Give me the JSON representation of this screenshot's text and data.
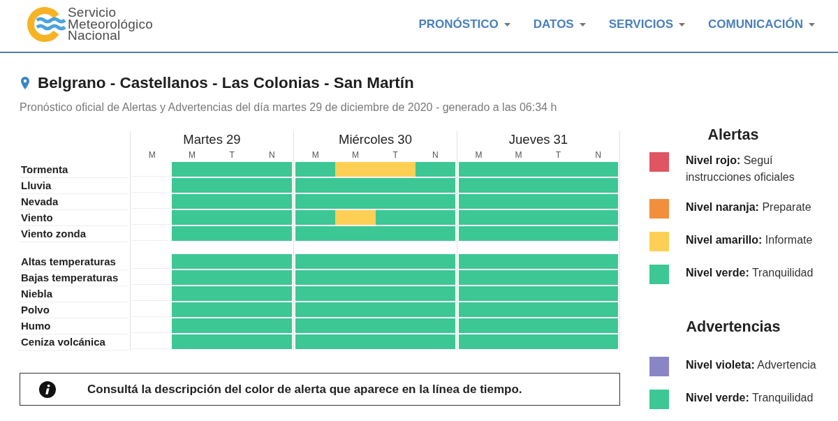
{
  "header": {
    "logo_lines": [
      "Servicio",
      "Meteorológico",
      "Nacional"
    ],
    "nav": [
      {
        "label": "PRONÓSTICO"
      },
      {
        "label": "DATOS"
      },
      {
        "label": "SERVICIOS"
      },
      {
        "label": "COMUNICACIÓN"
      }
    ]
  },
  "location": {
    "title": "Belgrano - Castellanos - Las Colonias - San Martín",
    "subtitle": "Pronóstico oficial de Alertas y Advertencias del día martes 29 de diciembre de 2020 - generado a las 06:34 h"
  },
  "timeline": {
    "days": [
      {
        "label": "Martes 29",
        "periods": [
          "M",
          "M",
          "T",
          "N"
        ]
      },
      {
        "label": "Miércoles 30",
        "periods": [
          "M",
          "M",
          "T",
          "N"
        ]
      },
      {
        "label": "Jueves 31",
        "periods": [
          "M",
          "M",
          "T",
          "N"
        ]
      }
    ],
    "groups": [
      {
        "rows": [
          {
            "label": "Tormenta",
            "alerts": [
              [
                {
                  "color": "#3cc795"
                },
                {
                  "color": "#3cc795"
                },
                {
                  "color": "#3cc795"
                }
              ],
              [
                {
                  "color": "#3cc795"
                },
                {
                  "color": "#fdd055"
                },
                {
                  "color": "#fdd055"
                },
                {
                  "color": "#3cc795"
                }
              ],
              [
                {
                  "color": "#3cc795"
                },
                {
                  "color": "#3cc795"
                },
                {
                  "color": "#3cc795"
                },
                {
                  "color": "#3cc795"
                }
              ]
            ]
          },
          {
            "label": "Lluvia",
            "alerts": [
              [
                {
                  "color": "#3cc795"
                },
                {
                  "color": "#3cc795"
                },
                {
                  "color": "#3cc795"
                }
              ],
              [
                {
                  "color": "#3cc795"
                },
                {
                  "color": "#3cc795"
                },
                {
                  "color": "#3cc795"
                },
                {
                  "color": "#3cc795"
                }
              ],
              [
                {
                  "color": "#3cc795"
                },
                {
                  "color": "#3cc795"
                },
                {
                  "color": "#3cc795"
                },
                {
                  "color": "#3cc795"
                }
              ]
            ]
          },
          {
            "label": "Nevada",
            "alerts": [
              [
                {
                  "color": "#3cc795"
                },
                {
                  "color": "#3cc795"
                },
                {
                  "color": "#3cc795"
                }
              ],
              [
                {
                  "color": "#3cc795"
                },
                {
                  "color": "#3cc795"
                },
                {
                  "color": "#3cc795"
                },
                {
                  "color": "#3cc795"
                }
              ],
              [
                {
                  "color": "#3cc795"
                },
                {
                  "color": "#3cc795"
                },
                {
                  "color": "#3cc795"
                },
                {
                  "color": "#3cc795"
                }
              ]
            ]
          },
          {
            "label": "Viento",
            "alerts": [
              [
                {
                  "color": "#3cc795"
                },
                {
                  "color": "#3cc795"
                },
                {
                  "color": "#3cc795"
                }
              ],
              [
                {
                  "color": "#3cc795"
                },
                {
                  "color": "#fdd055"
                },
                {
                  "color": "#3cc795"
                },
                {
                  "color": "#3cc795"
                }
              ],
              [
                {
                  "color": "#3cc795"
                },
                {
                  "color": "#3cc795"
                },
                {
                  "color": "#3cc795"
                },
                {
                  "color": "#3cc795"
                }
              ]
            ]
          },
          {
            "label": "Viento zonda",
            "alerts": [
              [
                {
                  "color": "#3cc795"
                },
                {
                  "color": "#3cc795"
                },
                {
                  "color": "#3cc795"
                }
              ],
              [
                {
                  "color": "#3cc795"
                },
                {
                  "color": "#3cc795"
                },
                {
                  "color": "#3cc795"
                },
                {
                  "color": "#3cc795"
                }
              ],
              [
                {
                  "color": "#3cc795"
                },
                {
                  "color": "#3cc795"
                },
                {
                  "color": "#3cc795"
                },
                {
                  "color": "#3cc795"
                }
              ]
            ]
          }
        ]
      },
      {
        "rows": [
          {
            "label": "Altas temperaturas",
            "alerts": [
              [
                {
                  "color": "#3cc795"
                },
                {
                  "color": "#3cc795"
                },
                {
                  "color": "#3cc795"
                }
              ],
              [
                {
                  "color": "#3cc795"
                },
                {
                  "color": "#3cc795"
                },
                {
                  "color": "#3cc795"
                },
                {
                  "color": "#3cc795"
                }
              ],
              [
                {
                  "color": "#3cc795"
                },
                {
                  "color": "#3cc795"
                },
                {
                  "color": "#3cc795"
                },
                {
                  "color": "#3cc795"
                }
              ]
            ]
          },
          {
            "label": "Bajas temperaturas",
            "alerts": [
              [
                {
                  "color": "#3cc795"
                },
                {
                  "color": "#3cc795"
                },
                {
                  "color": "#3cc795"
                }
              ],
              [
                {
                  "color": "#3cc795"
                },
                {
                  "color": "#3cc795"
                },
                {
                  "color": "#3cc795"
                },
                {
                  "color": "#3cc795"
                }
              ],
              [
                {
                  "color": "#3cc795"
                },
                {
                  "color": "#3cc795"
                },
                {
                  "color": "#3cc795"
                },
                {
                  "color": "#3cc795"
                }
              ]
            ]
          },
          {
            "label": "Niebla",
            "alerts": [
              [
                {
                  "color": "#3cc795"
                },
                {
                  "color": "#3cc795"
                },
                {
                  "color": "#3cc795"
                }
              ],
              [
                {
                  "color": "#3cc795"
                },
                {
                  "color": "#3cc795"
                },
                {
                  "color": "#3cc795"
                },
                {
                  "color": "#3cc795"
                }
              ],
              [
                {
                  "color": "#3cc795"
                },
                {
                  "color": "#3cc795"
                },
                {
                  "color": "#3cc795"
                },
                {
                  "color": "#3cc795"
                }
              ]
            ]
          },
          {
            "label": "Polvo",
            "alerts": [
              [
                {
                  "color": "#3cc795"
                },
                {
                  "color": "#3cc795"
                },
                {
                  "color": "#3cc795"
                }
              ],
              [
                {
                  "color": "#3cc795"
                },
                {
                  "color": "#3cc795"
                },
                {
                  "color": "#3cc795"
                },
                {
                  "color": "#3cc795"
                }
              ],
              [
                {
                  "color": "#3cc795"
                },
                {
                  "color": "#3cc795"
                },
                {
                  "color": "#3cc795"
                },
                {
                  "color": "#3cc795"
                }
              ]
            ]
          },
          {
            "label": "Humo",
            "alerts": [
              [
                {
                  "color": "#3cc795"
                },
                {
                  "color": "#3cc795"
                },
                {
                  "color": "#3cc795"
                }
              ],
              [
                {
                  "color": "#3cc795"
                },
                {
                  "color": "#3cc795"
                },
                {
                  "color": "#3cc795"
                },
                {
                  "color": "#3cc795"
                }
              ],
              [
                {
                  "color": "#3cc795"
                },
                {
                  "color": "#3cc795"
                },
                {
                  "color": "#3cc795"
                },
                {
                  "color": "#3cc795"
                }
              ]
            ]
          },
          {
            "label": "Ceniza volcánica",
            "alerts": [
              [
                {
                  "color": "#3cc795"
                },
                {
                  "color": "#3cc795"
                },
                {
                  "color": "#3cc795"
                }
              ],
              [
                {
                  "color": "#3cc795"
                },
                {
                  "color": "#3cc795"
                },
                {
                  "color": "#3cc795"
                },
                {
                  "color": "#3cc795"
                }
              ],
              [
                {
                  "color": "#3cc795"
                },
                {
                  "color": "#3cc795"
                },
                {
                  "color": "#3cc795"
                },
                {
                  "color": "#3cc795"
                }
              ]
            ]
          }
        ]
      }
    ]
  },
  "info": {
    "text": "Consultá la descripción del color de alerta que aparece en la línea de tiempo."
  },
  "legend": [
    {
      "title": "Alertas",
      "items": [
        {
          "text": "**Nivel rojo:** Seguí instrucciones oficiales",
          "color": "#df5561"
        },
        {
          "text": "**Nivel naranja:** Preparate",
          "color": "#f28f3c"
        },
        {
          "text": "**Nivel amarillo:** Informate",
          "color": "#fdd055"
        },
        {
          "text": "**Nivel verde:** Tranquilidad",
          "color": "#3cc795"
        }
      ]
    },
    {
      "title": "Advertencias",
      "items": [
        {
          "text": "**Nivel violeta:** Advertencia",
          "color": "#8a86c6"
        },
        {
          "text": "**Nivel verde:** Tranquilidad",
          "color": "#3cc795"
        }
      ]
    }
  ]
}
